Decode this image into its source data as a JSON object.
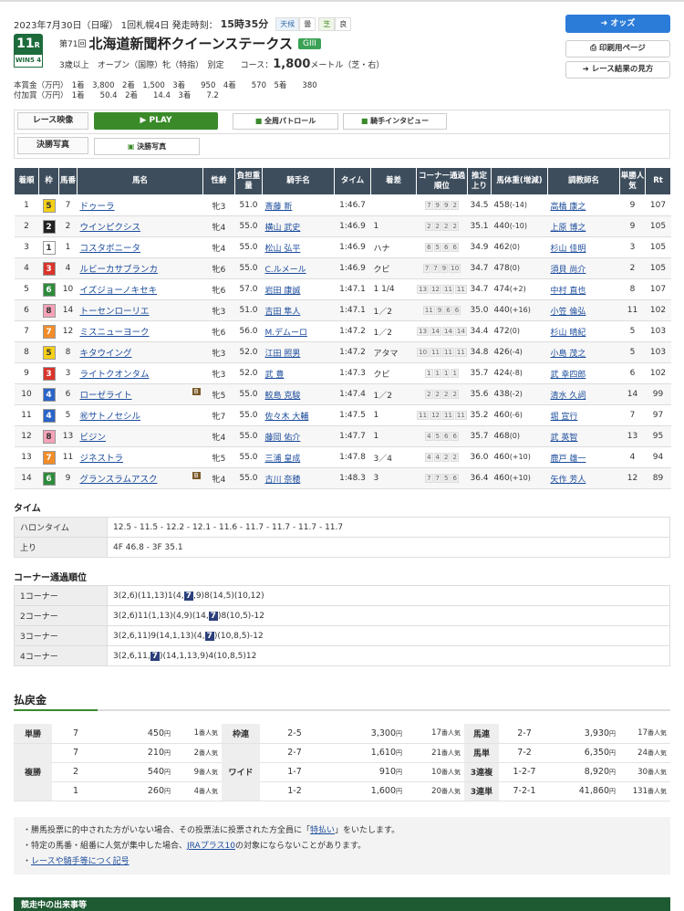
{
  "race": {
    "date_line": "2023年7月30日（日曜） 1回札幌4日 発走時刻：",
    "start_time": "15時35分",
    "weather_label": "天候",
    "weather_value": "曇",
    "turf_label": "芝",
    "turf_value": "良",
    "race_number": "11",
    "race_suffix": "R",
    "win5": "WIN5 4",
    "edition": "第71回",
    "name": "北海道新聞杯クイーンステークス",
    "grade": "GIII",
    "conditions": "3歳以上　オープン（国際）牝（特指）　別定　　コース：",
    "distance": "1,800",
    "distance_unit": "メートル（芝・右）",
    "prize_text": "本賞金（万円）　1着　3,800　2着　1,500　3着　　950　4着　　570　5着　　380\n付加賞（万円）　1着　　50.4　2着　　14.4　3着　　7.2"
  },
  "side": {
    "odds": "オッズ",
    "print": "印刷用ページ",
    "howto": "レース結果の見方"
  },
  "media": {
    "video_label": "レース映像",
    "play": "PLAY",
    "patrol": "全周パトロール",
    "interview": "騎手インタビュー",
    "photo_label": "決勝写真",
    "photo_btn": "決勝写真"
  },
  "headers": [
    "着順",
    "枠",
    "馬番",
    "馬名",
    "性齢",
    "負担重量",
    "騎手名",
    "タイム",
    "着差",
    "コーナー通過順位",
    "推定上り",
    "馬体重(増減)",
    "調教師名",
    "単勝人気",
    "Rt"
  ],
  "results": [
    {
      "rank": "1",
      "frame": "5",
      "num": "7",
      "horse": "ドゥーラ",
      "b": "",
      "sa": "牝3",
      "wt": "51.0",
      "jockey": "斎藤 新",
      "time": "1:46.7",
      "margin": "",
      "pos": [
        "7",
        "9",
        "9",
        "2"
      ],
      "up": "34.5",
      "bw": "458",
      "bwd": "(-14)",
      "trainer": "高橋 康之",
      "pop": "9",
      "rt": "107"
    },
    {
      "rank": "2",
      "frame": "2",
      "num": "2",
      "horse": "ウインピクシス",
      "b": "",
      "sa": "牝4",
      "wt": "55.0",
      "jockey": "横山 武史",
      "time": "1:46.9",
      "margin": "1",
      "pos": [
        "2",
        "2",
        "2",
        "2"
      ],
      "up": "35.1",
      "bw": "440",
      "bwd": "(-10)",
      "trainer": "上原 博之",
      "pop": "9",
      "rt": "105"
    },
    {
      "rank": "3",
      "frame": "1",
      "num": "1",
      "horse": "コスタボニータ",
      "b": "",
      "sa": "牝4",
      "wt": "55.0",
      "jockey": "松山 弘平",
      "time": "1:46.9",
      "margin": "ハナ",
      "pos": [
        "6",
        "5",
        "6",
        "6"
      ],
      "up": "34.9",
      "bw": "462",
      "bwd": "(0)",
      "trainer": "杉山 佳明",
      "pop": "3",
      "rt": "105"
    },
    {
      "rank": "4",
      "frame": "3",
      "num": "4",
      "horse": "ルビーカサブランカ",
      "b": "",
      "sa": "牝6",
      "wt": "55.0",
      "jockey": "C.ルメール",
      "time": "1:46.9",
      "margin": "クビ",
      "pos": [
        "7",
        "7",
        "9",
        "10"
      ],
      "up": "34.7",
      "bw": "478",
      "bwd": "(0)",
      "trainer": "須貝 尚介",
      "pop": "2",
      "rt": "105"
    },
    {
      "rank": "5",
      "frame": "6",
      "num": "10",
      "horse": "イズジョーノキセキ",
      "b": "",
      "sa": "牝6",
      "wt": "57.0",
      "jockey": "岩田 康誠",
      "time": "1:47.1",
      "margin": "1 1/4",
      "pos": [
        "13",
        "12",
        "11",
        "11"
      ],
      "up": "34.7",
      "bw": "474",
      "bwd": "(+2)",
      "trainer": "中村 直也",
      "pop": "8",
      "rt": "107"
    },
    {
      "rank": "6",
      "frame": "8",
      "num": "14",
      "horse": "トーセンローリエ",
      "b": "",
      "sa": "牝3",
      "wt": "51.0",
      "jockey": "吉田 隼人",
      "time": "1:47.1",
      "margin": "1／2",
      "pos": [
        "11",
        "9",
        "6",
        "6"
      ],
      "up": "35.0",
      "bw": "440",
      "bwd": "(+16)",
      "trainer": "小笠 倫弘",
      "pop": "11",
      "rt": "102"
    },
    {
      "rank": "7",
      "frame": "7",
      "num": "12",
      "horse": "ミスニューヨーク",
      "b": "",
      "sa": "牝6",
      "wt": "56.0",
      "jockey": "M.デムーロ",
      "time": "1:47.2",
      "margin": "1／2",
      "pos": [
        "13",
        "14",
        "14",
        "14"
      ],
      "up": "34.4",
      "bw": "472",
      "bwd": "(0)",
      "trainer": "杉山 晴紀",
      "pop": "5",
      "rt": "103"
    },
    {
      "rank": "8",
      "frame": "5",
      "num": "8",
      "horse": "キタウイング",
      "b": "",
      "sa": "牝3",
      "wt": "52.0",
      "jockey": "江田 照男",
      "time": "1:47.2",
      "margin": "アタマ",
      "pos": [
        "10",
        "11",
        "11",
        "11"
      ],
      "up": "34.8",
      "bw": "426",
      "bwd": "(-4)",
      "trainer": "小島 茂之",
      "pop": "5",
      "rt": "103"
    },
    {
      "rank": "9",
      "frame": "3",
      "num": "3",
      "horse": "ライトクオンタム",
      "b": "",
      "sa": "牝3",
      "wt": "52.0",
      "jockey": "武 豊",
      "time": "1:47.3",
      "margin": "クビ",
      "pos": [
        "1",
        "1",
        "1",
        "1"
      ],
      "up": "35.7",
      "bw": "424",
      "bwd": "(-8)",
      "trainer": "武 幸四郎",
      "pop": "6",
      "rt": "102"
    },
    {
      "rank": "10",
      "frame": "4",
      "num": "6",
      "horse": "ローゼライト",
      "b": "B",
      "sa": "牝5",
      "wt": "55.0",
      "jockey": "鮫島 克駿",
      "time": "1:47.4",
      "margin": "1／2",
      "pos": [
        "2",
        "2",
        "2",
        "2"
      ],
      "up": "35.6",
      "bw": "438",
      "bwd": "(-2)",
      "trainer": "清水 久詞",
      "pop": "14",
      "rt": "99"
    },
    {
      "rank": "11",
      "frame": "4",
      "num": "5",
      "horse": "㊗サトノセシル",
      "b": "",
      "sa": "牝7",
      "wt": "55.0",
      "jockey": "佐々木 大輔",
      "time": "1:47.5",
      "margin": "1",
      "pos": [
        "11",
        "12",
        "11",
        "11"
      ],
      "up": "35.2",
      "bw": "460",
      "bwd": "(-6)",
      "trainer": "堀 宣行",
      "pop": "7",
      "rt": "97"
    },
    {
      "rank": "12",
      "frame": "8",
      "num": "13",
      "horse": "ビジン",
      "b": "",
      "sa": "牝4",
      "wt": "55.0",
      "jockey": "藤岡 佑介",
      "time": "1:47.7",
      "margin": "1",
      "pos": [
        "4",
        "5",
        "6",
        "6"
      ],
      "up": "35.7",
      "bw": "468",
      "bwd": "(0)",
      "trainer": "武 英智",
      "pop": "13",
      "rt": "95"
    },
    {
      "rank": "13",
      "frame": "7",
      "num": "11",
      "horse": "ジネストラ",
      "b": "",
      "sa": "牝5",
      "wt": "55.0",
      "jockey": "三浦 皇成",
      "time": "1:47.8",
      "margin": "3／4",
      "pos": [
        "4",
        "4",
        "2",
        "2"
      ],
      "up": "36.0",
      "bw": "460",
      "bwd": "(+10)",
      "trainer": "鹿戸 雄一",
      "pop": "4",
      "rt": "94"
    },
    {
      "rank": "14",
      "frame": "6",
      "num": "9",
      "horse": "グランスラムアスク",
      "b": "B",
      "sa": "牝4",
      "wt": "55.0",
      "jockey": "古川 奈穂",
      "time": "1:48.3",
      "margin": "3",
      "pos": [
        "7",
        "7",
        "5",
        "6"
      ],
      "up": "36.4",
      "bw": "460",
      "bwd": "(+10)",
      "trainer": "矢作 芳人",
      "pop": "12",
      "rt": "89"
    }
  ],
  "frame_colors": {
    "1": [
      "#ffffff",
      "#333"
    ],
    "2": [
      "#222222",
      "#fff"
    ],
    "3": [
      "#d9342b",
      "#fff"
    ],
    "4": [
      "#2b64c8",
      "#fff"
    ],
    "5": [
      "#f5d017",
      "#333"
    ],
    "6": [
      "#2e8b3c",
      "#fff"
    ],
    "7": [
      "#f28c28",
      "#fff"
    ],
    "8": [
      "#f5a3b8",
      "#333"
    ]
  },
  "time_section": {
    "title": "タイム",
    "halon_label": "ハロンタイム",
    "halon": "12.5 - 11.5 - 12.2 - 12.1 - 11.6 - 11.7 - 11.7 - 11.7 - 11.7",
    "agari_label": "上り",
    "agari": "4F 46.8 - 3F 35.1"
  },
  "corner_section": {
    "title": "コーナー通過順位",
    "rows": [
      {
        "label": "1コーナー",
        "pre": "3(2,6)(11,13)1(4,",
        "hl": "7",
        "post": ",9)8(14,5)(10,12)"
      },
      {
        "label": "2コーナー",
        "pre": "3(2,6)11(1,13)(4,9)(14,",
        "hl": "7",
        "post": ")8(10,5)-12"
      },
      {
        "label": "3コーナー",
        "pre": "3(2,6,11)9(14,1,13)(4,",
        "hl": "7",
        "post": ")(10,8,5)-12"
      },
      {
        "label": "4コーナー",
        "pre": "3(2,6,11,",
        "hl": "7",
        "post": ")(14,1,13,9)4(10,8,5)12"
      }
    ]
  },
  "payout": {
    "title": "払戻金",
    "unit": "円",
    "pop_unit": "番人気",
    "tansho": {
      "label": "単勝",
      "rows": [
        {
          "c": "7",
          "y": "450",
          "p": "1"
        }
      ]
    },
    "fukusho": {
      "label": "複勝",
      "rows": [
        {
          "c": "7",
          "y": "210",
          "p": "2"
        },
        {
          "c": "2",
          "y": "540",
          "p": "9"
        },
        {
          "c": "1",
          "y": "260",
          "p": "4"
        }
      ]
    },
    "wakuren": {
      "label": "枠連",
      "rows": [
        {
          "c": "2-5",
          "y": "3,300",
          "p": "17"
        }
      ]
    },
    "wide": {
      "label": "ワイド",
      "rows": [
        {
          "c": "2-7",
          "y": "1,610",
          "p": "21"
        },
        {
          "c": "1-7",
          "y": "910",
          "p": "10"
        },
        {
          "c": "1-2",
          "y": "1,600",
          "p": "20"
        }
      ]
    },
    "umaren": {
      "label": "馬連",
      "rows": [
        {
          "c": "2-7",
          "y": "3,930",
          "p": "17"
        }
      ]
    },
    "umatan": {
      "label": "馬単",
      "rows": [
        {
          "c": "7-2",
          "y": "6,350",
          "p": "24"
        }
      ]
    },
    "trio": {
      "label": "3連複",
      "rows": [
        {
          "c": "1-2-7",
          "y": "8,920",
          "p": "30"
        }
      ]
    },
    "trifecta": {
      "label": "3連単",
      "rows": [
        {
          "c": "7-2-1",
          "y": "41,860",
          "p": "131"
        }
      ]
    }
  },
  "notes": {
    "n1_pre": "・勝馬投票に的中された方がいない場合、その投票法に投票された方全員に「",
    "n1_link": "特払い",
    "n1_post": "」をいたします。",
    "n2_pre": "・特定の馬番・組番に人気が集中した場合、",
    "n2_link": "JRAプラス10",
    "n2_post": "の対象にならないことがあります。",
    "n3_pre": "・",
    "n3_link": "レースや騎手等につく記号"
  },
  "bottom_bar": "競走中の出来事等"
}
